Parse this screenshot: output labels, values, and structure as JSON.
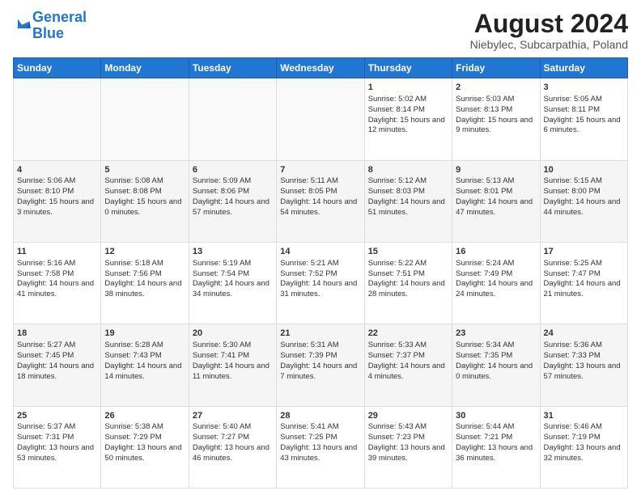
{
  "header": {
    "logo_line1": "General",
    "logo_line2": "Blue",
    "month_title": "August 2024",
    "location": "Niebylec, Subcarpathia, Poland"
  },
  "columns": [
    "Sunday",
    "Monday",
    "Tuesday",
    "Wednesday",
    "Thursday",
    "Friday",
    "Saturday"
  ],
  "weeks": [
    [
      {
        "day": "",
        "text": ""
      },
      {
        "day": "",
        "text": ""
      },
      {
        "day": "",
        "text": ""
      },
      {
        "day": "",
        "text": ""
      },
      {
        "day": "1",
        "text": "Sunrise: 5:02 AM\nSunset: 8:14 PM\nDaylight: 15 hours and 12 minutes."
      },
      {
        "day": "2",
        "text": "Sunrise: 5:03 AM\nSunset: 8:13 PM\nDaylight: 15 hours and 9 minutes."
      },
      {
        "day": "3",
        "text": "Sunrise: 5:05 AM\nSunset: 8:11 PM\nDaylight: 15 hours and 6 minutes."
      }
    ],
    [
      {
        "day": "4",
        "text": "Sunrise: 5:06 AM\nSunset: 8:10 PM\nDaylight: 15 hours and 3 minutes."
      },
      {
        "day": "5",
        "text": "Sunrise: 5:08 AM\nSunset: 8:08 PM\nDaylight: 15 hours and 0 minutes."
      },
      {
        "day": "6",
        "text": "Sunrise: 5:09 AM\nSunset: 8:06 PM\nDaylight: 14 hours and 57 minutes."
      },
      {
        "day": "7",
        "text": "Sunrise: 5:11 AM\nSunset: 8:05 PM\nDaylight: 14 hours and 54 minutes."
      },
      {
        "day": "8",
        "text": "Sunrise: 5:12 AM\nSunset: 8:03 PM\nDaylight: 14 hours and 51 minutes."
      },
      {
        "day": "9",
        "text": "Sunrise: 5:13 AM\nSunset: 8:01 PM\nDaylight: 14 hours and 47 minutes."
      },
      {
        "day": "10",
        "text": "Sunrise: 5:15 AM\nSunset: 8:00 PM\nDaylight: 14 hours and 44 minutes."
      }
    ],
    [
      {
        "day": "11",
        "text": "Sunrise: 5:16 AM\nSunset: 7:58 PM\nDaylight: 14 hours and 41 minutes."
      },
      {
        "day": "12",
        "text": "Sunrise: 5:18 AM\nSunset: 7:56 PM\nDaylight: 14 hours and 38 minutes."
      },
      {
        "day": "13",
        "text": "Sunrise: 5:19 AM\nSunset: 7:54 PM\nDaylight: 14 hours and 34 minutes."
      },
      {
        "day": "14",
        "text": "Sunrise: 5:21 AM\nSunset: 7:52 PM\nDaylight: 14 hours and 31 minutes."
      },
      {
        "day": "15",
        "text": "Sunrise: 5:22 AM\nSunset: 7:51 PM\nDaylight: 14 hours and 28 minutes."
      },
      {
        "day": "16",
        "text": "Sunrise: 5:24 AM\nSunset: 7:49 PM\nDaylight: 14 hours and 24 minutes."
      },
      {
        "day": "17",
        "text": "Sunrise: 5:25 AM\nSunset: 7:47 PM\nDaylight: 14 hours and 21 minutes."
      }
    ],
    [
      {
        "day": "18",
        "text": "Sunrise: 5:27 AM\nSunset: 7:45 PM\nDaylight: 14 hours and 18 minutes."
      },
      {
        "day": "19",
        "text": "Sunrise: 5:28 AM\nSunset: 7:43 PM\nDaylight: 14 hours and 14 minutes."
      },
      {
        "day": "20",
        "text": "Sunrise: 5:30 AM\nSunset: 7:41 PM\nDaylight: 14 hours and 11 minutes."
      },
      {
        "day": "21",
        "text": "Sunrise: 5:31 AM\nSunset: 7:39 PM\nDaylight: 14 hours and 7 minutes."
      },
      {
        "day": "22",
        "text": "Sunrise: 5:33 AM\nSunset: 7:37 PM\nDaylight: 14 hours and 4 minutes."
      },
      {
        "day": "23",
        "text": "Sunrise: 5:34 AM\nSunset: 7:35 PM\nDaylight: 14 hours and 0 minutes."
      },
      {
        "day": "24",
        "text": "Sunrise: 5:36 AM\nSunset: 7:33 PM\nDaylight: 13 hours and 57 minutes."
      }
    ],
    [
      {
        "day": "25",
        "text": "Sunrise: 5:37 AM\nSunset: 7:31 PM\nDaylight: 13 hours and 53 minutes."
      },
      {
        "day": "26",
        "text": "Sunrise: 5:38 AM\nSunset: 7:29 PM\nDaylight: 13 hours and 50 minutes."
      },
      {
        "day": "27",
        "text": "Sunrise: 5:40 AM\nSunset: 7:27 PM\nDaylight: 13 hours and 46 minutes."
      },
      {
        "day": "28",
        "text": "Sunrise: 5:41 AM\nSunset: 7:25 PM\nDaylight: 13 hours and 43 minutes."
      },
      {
        "day": "29",
        "text": "Sunrise: 5:43 AM\nSunset: 7:23 PM\nDaylight: 13 hours and 39 minutes."
      },
      {
        "day": "30",
        "text": "Sunrise: 5:44 AM\nSunset: 7:21 PM\nDaylight: 13 hours and 36 minutes."
      },
      {
        "day": "31",
        "text": "Sunrise: 5:46 AM\nSunset: 7:19 PM\nDaylight: 13 hours and 32 minutes."
      }
    ]
  ]
}
